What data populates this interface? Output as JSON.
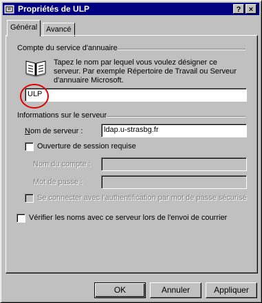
{
  "window": {
    "title": "Propriétés de ULP",
    "help_button": "?",
    "close_button": "×"
  },
  "tabs": [
    {
      "label": "Général",
      "active": true
    },
    {
      "label": "Avancé",
      "active": false
    }
  ],
  "directory": {
    "group_label": "Compte du service d'annuaire",
    "description": "Tapez le nom par lequel vous voulez désigner ce serveur. Par exemple Répertoire de Travail ou Serveur d'annuaire Microsoft.",
    "name_value": "ULP"
  },
  "server": {
    "group_label": "Informations sur le serveur",
    "server_name_label": "Nom de serveur :",
    "server_name_value": "ldap.u-strasbg.fr",
    "logon_required_label": "Ouverture de session requise",
    "account_label": "Nom du compte :",
    "password_label": "Mot de passe :",
    "spa_label": "Se connecter avec l'authentification par mot de passe sécurisé"
  },
  "verify_names_label": "Vérifier les noms avec ce serveur lors de l'envoi de courrier",
  "buttons": {
    "ok": "OK",
    "cancel": "Annuler",
    "apply": "Appliquer"
  },
  "colors": {
    "titlebar": "#000080",
    "face": "#c0c0c0",
    "highlight_circle": "#e00000"
  }
}
